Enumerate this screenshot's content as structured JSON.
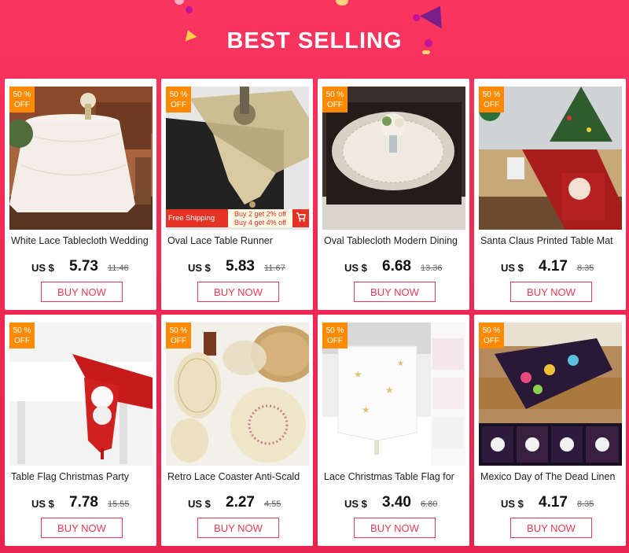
{
  "banner": {
    "title": "BEST SELLING"
  },
  "products": [
    {
      "title": "White Lace Tablecloth Wedding",
      "currency": "US $",
      "price": "5.73",
      "old_price": "11.46",
      "badge": [
        "50 %",
        "OFF"
      ],
      "buy_label": "BUY NOW"
    },
    {
      "title": "Oval Lace Table Runner",
      "currency": "US $",
      "price": "5.83",
      "old_price": "11.67",
      "badge": [
        "50 %",
        "OFF"
      ],
      "buy_label": "BUY NOW",
      "shipping": {
        "label": "Free Shipping",
        "promo_line1": "Buy 2 get 2% off",
        "promo_line2": "Buy 4 get 4% off"
      }
    },
    {
      "title": "Oval Tablecloth Modern Dining",
      "currency": "US $",
      "price": "6.68",
      "old_price": "13.36",
      "badge": [
        "50 %",
        "OFF"
      ],
      "buy_label": "BUY NOW"
    },
    {
      "title": "Santa Claus Printed Table Mat",
      "currency": "US $",
      "price": "4.17",
      "old_price": "8.35",
      "badge": [
        "50 %",
        "OFF"
      ],
      "buy_label": "BUY NOW"
    },
    {
      "title": "Table Flag Christmas Party",
      "currency": "US $",
      "price": "7.78",
      "old_price": "15.55",
      "badge": [
        "50 %",
        "OFF"
      ],
      "buy_label": "BUY NOW"
    },
    {
      "title": "Retro Lace Coaster Anti-Scald",
      "currency": "US $",
      "price": "2.27",
      "old_price": "4.55",
      "badge": [
        "50 %",
        "OFF"
      ],
      "buy_label": "BUY NOW"
    },
    {
      "title": "Lace Christmas Table Flag for",
      "currency": "US $",
      "price": "3.40",
      "old_price": "6.80",
      "badge": [
        "50 %",
        "OFF"
      ],
      "buy_label": "BUY NOW"
    },
    {
      "title": "Mexico Day of The Dead Linen",
      "currency": "US $",
      "price": "4.17",
      "old_price": "8.35",
      "badge": [
        "50 %",
        "OFF"
      ],
      "buy_label": "BUY NOW"
    }
  ],
  "colors": {
    "background": "#f02a55",
    "badge": "#ff8a00",
    "button": "#e83a55",
    "shipping_bar": "#e43325"
  }
}
